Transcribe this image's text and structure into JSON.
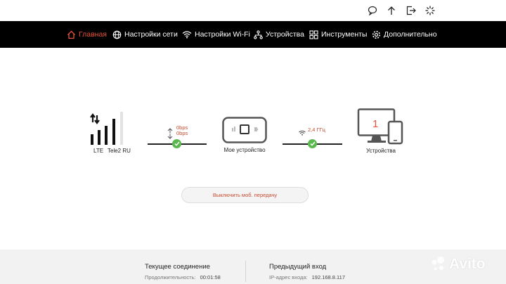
{
  "nav": {
    "items": [
      {
        "label": "Главная",
        "icon": "home-icon",
        "active": true
      },
      {
        "label": "Настройки сети",
        "icon": "globe-icon"
      },
      {
        "label": "Настройки Wi-Fi",
        "icon": "wifi-icon"
      },
      {
        "label": "Устройства",
        "icon": "devices-icon"
      },
      {
        "label": "Инструменты",
        "icon": "tools-icon"
      },
      {
        "label": "Дополнительно",
        "icon": "gear-icon"
      }
    ]
  },
  "top_icons": [
    "message-icon",
    "upload-icon",
    "logout-icon",
    "loading-icon"
  ],
  "status": {
    "network_type": "LTE",
    "operator": "Tele2 RU",
    "upload_speed": "0bps",
    "download_speed": "0bps",
    "device_label": "Мое устройство",
    "wifi_band": "2,4 ГГц",
    "devices_count": "1",
    "devices_label": "Устройства"
  },
  "actions": {
    "disable_mobile_data": "Выключить моб. передачу"
  },
  "footer": {
    "current_title": "Текущее соединение",
    "duration_label": "Продолжительность:",
    "duration_value": "00:01:58",
    "previous_title": "Предыдущий вход",
    "ip_label": "IP-адрес входа:",
    "ip_value": "192.168.8.117"
  },
  "watermark": "Avito",
  "colors": {
    "accent": "#e8533b",
    "success": "#5ab84f",
    "navbar": "#000000",
    "devices_number": "#e8533b"
  }
}
